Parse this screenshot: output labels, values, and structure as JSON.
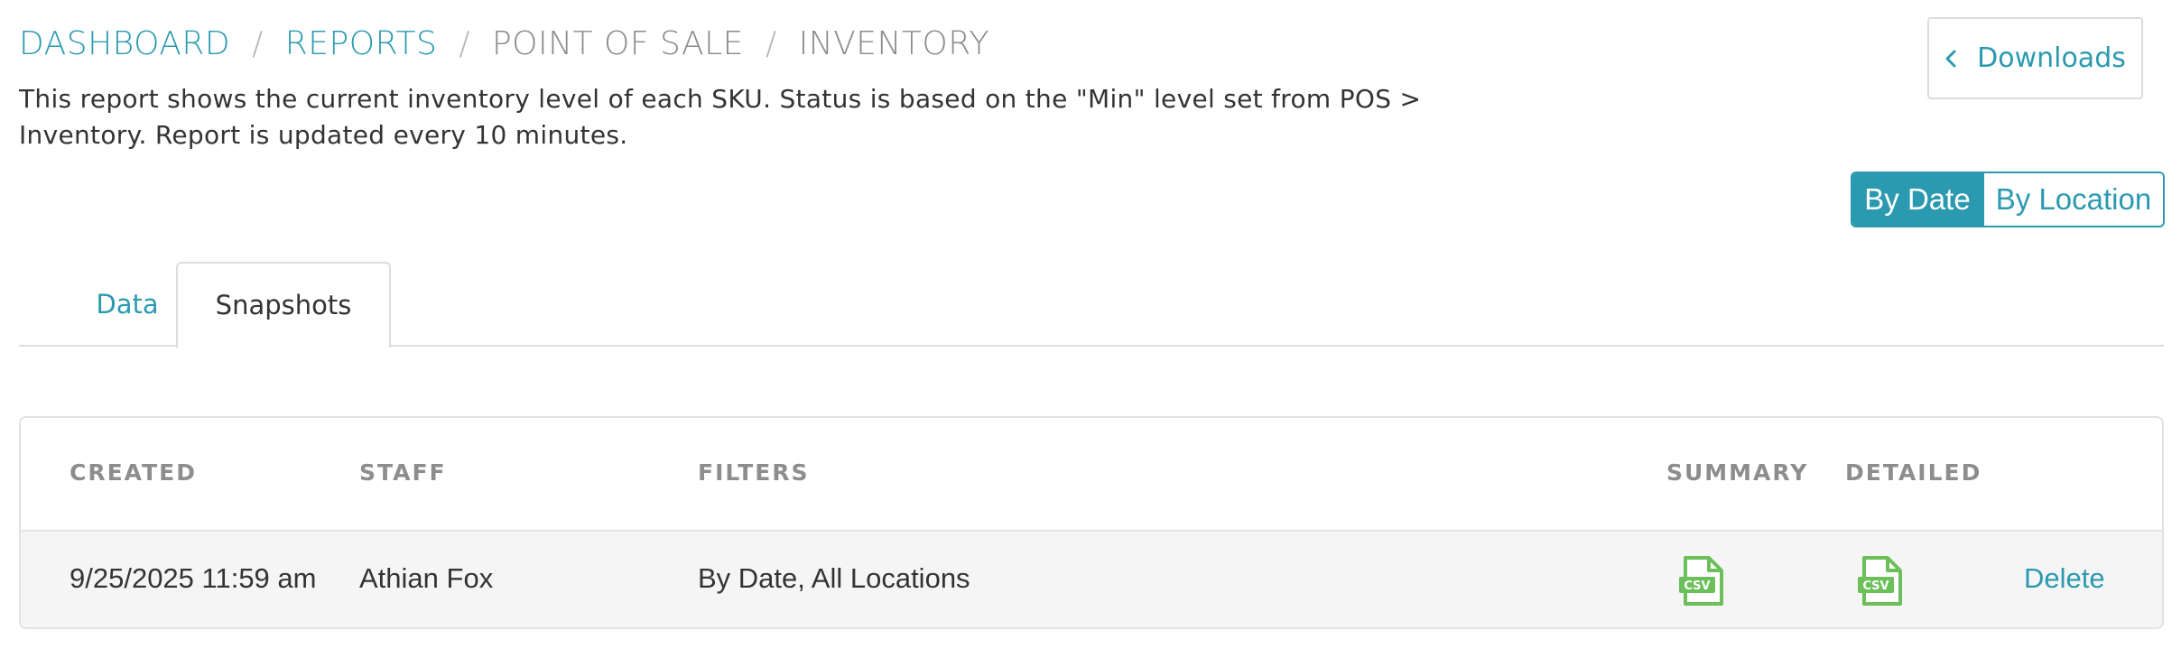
{
  "breadcrumb": {
    "items": [
      "DASHBOARD",
      "REPORTS",
      "POINT OF SALE"
    ],
    "current": "INVENTORY",
    "separator": "/"
  },
  "description": {
    "line1": "This report shows the current inventory level of each SKU. Status is based on the \"Min\" level set from POS >",
    "line2_prefix": "Inventory.",
    "line2_emph": "Report is updated every 10 minutes."
  },
  "header": {
    "downloads_label": "Downloads"
  },
  "view_toggle": {
    "options": [
      "By Date",
      "By Location"
    ],
    "selected": "By Date"
  },
  "tabs": [
    {
      "label": "Data",
      "active": false
    },
    {
      "label": "Snapshots",
      "active": true
    }
  ],
  "table": {
    "columns": [
      "CREATED",
      "STAFF",
      "FILTERS",
      "SUMMARY",
      "DETAILED"
    ],
    "rows": [
      {
        "created": "9/25/2025 11:59 am",
        "staff": "Athian Fox",
        "filters": "By Date, All Locations",
        "summary_icon": "csv-file-icon",
        "detailed_icon": "csv-file-icon",
        "csv_label": "CSV",
        "action": "Delete"
      }
    ]
  },
  "colors": {
    "accent": "#2b9ab0",
    "csv_green": "#6cc05a",
    "muted_text": "#8d8d8d",
    "row_bg": "#f5f5f5"
  }
}
